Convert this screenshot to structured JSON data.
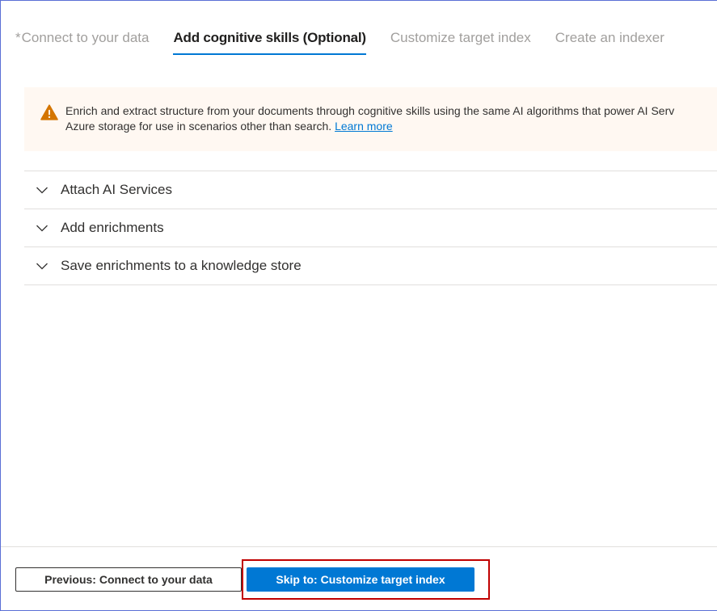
{
  "tabs": [
    {
      "required_mark": "*",
      "label": "Connect to your data"
    },
    {
      "label": "Add cognitive skills (Optional)"
    },
    {
      "label": "Customize target index"
    },
    {
      "label": "Create an indexer"
    }
  ],
  "active_tab": "Add cognitive skills (Optional)",
  "banner": {
    "icon": "warning-icon",
    "line1": "Enrich and extract structure from your documents through cognitive skills using the same AI algorithms that power AI Serv",
    "line2": "Azure storage for use in scenarios other than search.",
    "link": "Learn more"
  },
  "accordion": [
    {
      "label": "Attach AI Services",
      "icon": "chevron-down-icon"
    },
    {
      "label": "Add enrichments",
      "icon": "chevron-down-icon"
    },
    {
      "label": "Save enrichments to a knowledge store",
      "icon": "chevron-down-icon"
    }
  ],
  "footer": {
    "previous_label": "Previous: Connect to your data",
    "skip_label": "Skip to: Customize target index"
  },
  "colors": {
    "accent": "#0078d4",
    "warning": "#d47500",
    "banner_bg": "#fff8f2",
    "highlight": "#c00000"
  }
}
